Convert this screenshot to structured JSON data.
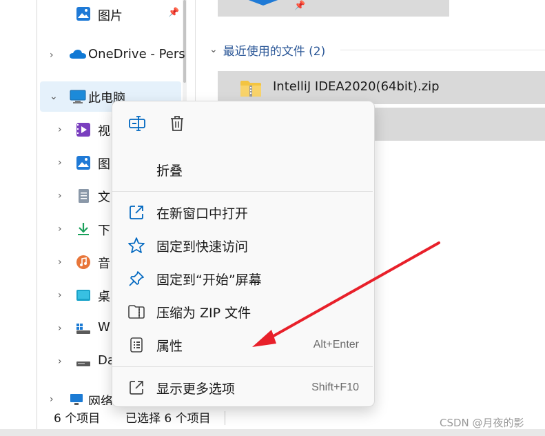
{
  "sidebar": {
    "items": [
      {
        "label": "图片",
        "pinned": true,
        "icon": "pictures-icon"
      },
      {
        "label": "OneDrive - Pers",
        "icon": "onedrive-icon"
      },
      {
        "label": "此电脑",
        "icon": "this-pc-icon"
      },
      {
        "label": "视",
        "icon": "videos-icon"
      },
      {
        "label": "图",
        "icon": "pictures-icon"
      },
      {
        "label": "文",
        "icon": "documents-icon"
      },
      {
        "label": "下",
        "icon": "downloads-icon"
      },
      {
        "label": "音",
        "icon": "music-icon"
      },
      {
        "label": "桌",
        "icon": "desktop-icon"
      },
      {
        "label": "W",
        "icon": "drive-icon"
      },
      {
        "label": "Da",
        "icon": "drive-icon"
      },
      {
        "label": "网络",
        "icon": "network-icon"
      }
    ]
  },
  "main": {
    "group_header": "最近使用的文件 (2)",
    "files": [
      {
        "name": "IntelliJ IDEA2020(64bit).zip",
        "icon": "zip-folder-icon"
      },
      {
        "name": "",
        "icon": "file-icon"
      }
    ]
  },
  "status": {
    "count": "6 个项目",
    "selected": "已选择 6 个项目"
  },
  "context_menu": {
    "top_buttons": [
      {
        "name": "rename-icon"
      },
      {
        "name": "delete-icon"
      }
    ],
    "items": [
      {
        "label": "折叠",
        "shortcut": ""
      },
      {
        "label": "在新窗口中打开",
        "shortcut": "",
        "icon": "open-new-window-icon"
      },
      {
        "label": "固定到快速访问",
        "shortcut": "",
        "icon": "star-icon"
      },
      {
        "label": "固定到“开始”屏幕",
        "shortcut": "",
        "icon": "pin-icon"
      },
      {
        "label": "压缩为 ZIP 文件",
        "shortcut": "",
        "icon": "zip-icon"
      },
      {
        "label": "属性",
        "shortcut": "Alt+Enter",
        "icon": "properties-icon"
      },
      {
        "label": "显示更多选项",
        "shortcut": "Shift+F10",
        "icon": "more-options-icon"
      }
    ]
  },
  "watermark": "CSDN @月夜的影",
  "colors": {
    "accent": "#0067c0",
    "annotation_arrow": "#e8202a",
    "selected_bg": "#e5f1fb"
  }
}
